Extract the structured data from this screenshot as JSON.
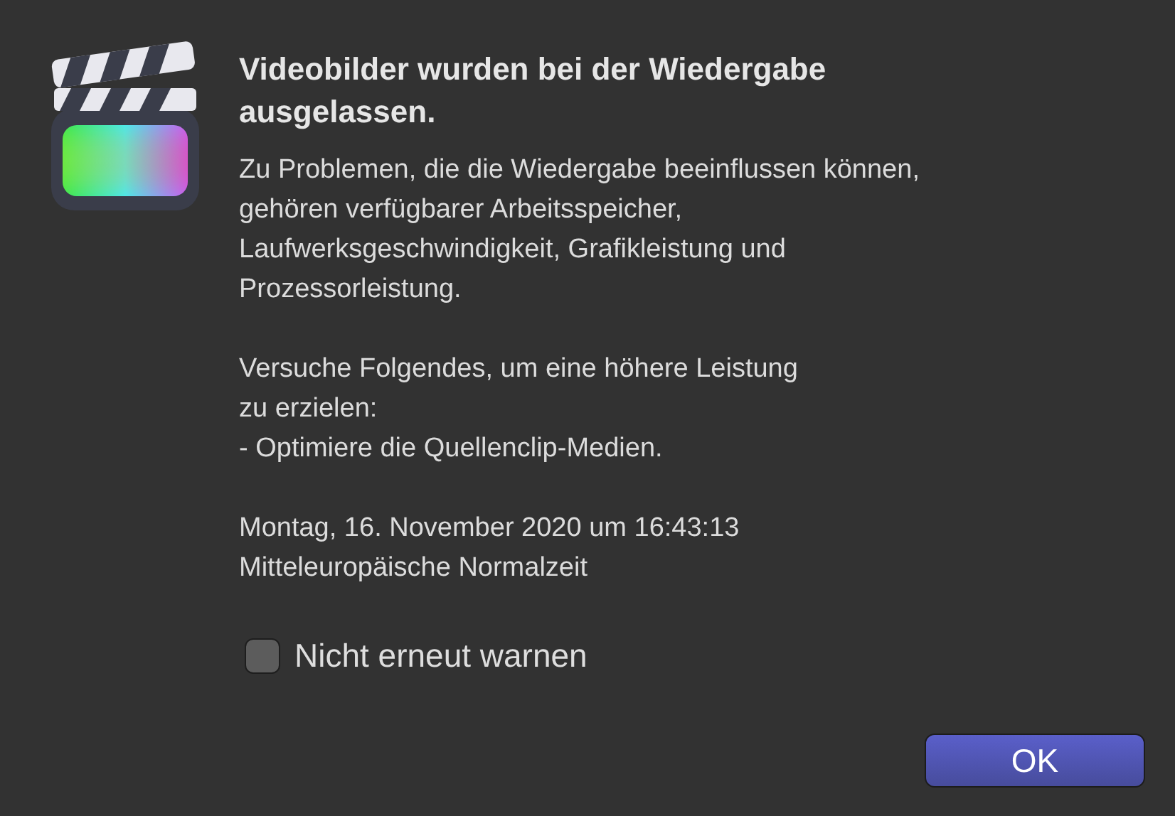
{
  "dialog": {
    "title": "Videobilder wurden bei der Wiedergabe\nausgelassen.",
    "paragraphs": [
      "Zu Problemen, die die Wiedergabe beeinflussen können,\ngehören verfügbarer Arbeitsspeicher,\nLaufwerksgeschwindigkeit, Grafikleistung und\nProzessorleistung.",
      "Versuche Folgendes, um eine höhere Leistung\nzu erzielen:\n- Optimiere die Quellenclip-Medien.",
      "Montag, 16. November 2020 um 16:43:13\nMitteleuropäische Normalzeit"
    ],
    "checkbox": {
      "label": "Nicht erneut warnen",
      "checked": false
    },
    "buttons": [
      {
        "label": "OK",
        "kind": "default"
      }
    ]
  }
}
